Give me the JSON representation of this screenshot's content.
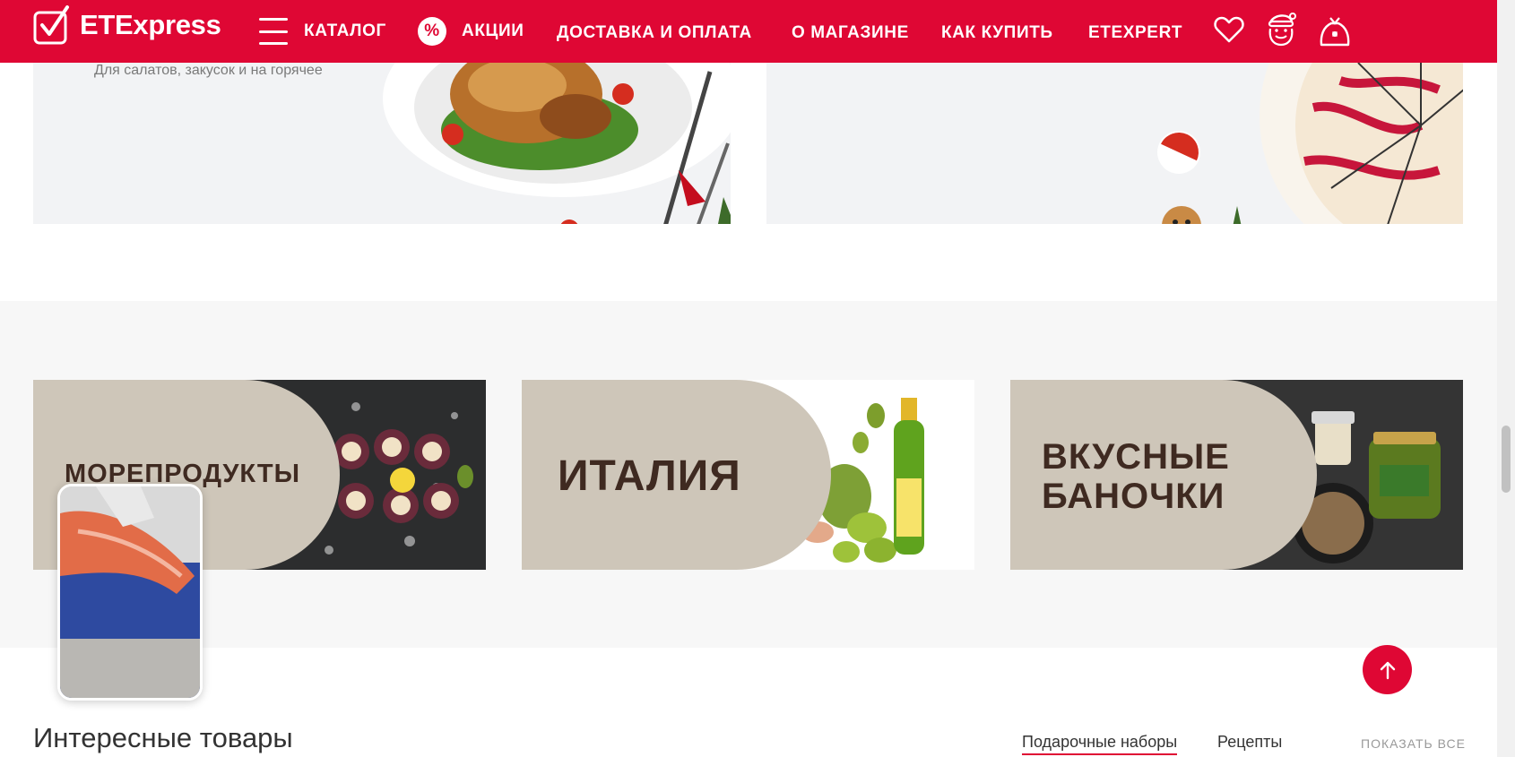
{
  "header": {
    "logo_text": "ETExpress",
    "nav": {
      "catalog": "КАТАЛОГ",
      "promo_icon": "%",
      "promo": "АКЦИИ",
      "delivery": "ДОСТАВКА И ОПЛАТА",
      "about": "О МАГАЗИНЕ",
      "how_to_buy": "КАК КУПИТЬ",
      "etexpert": "ETEXPERT"
    }
  },
  "banners": {
    "left_subtitle": "Для салатов, закусок и на горячее"
  },
  "categories": [
    {
      "label": "МОРЕПРОДУКТЫ"
    },
    {
      "label": "ИТАЛИЯ"
    },
    {
      "label_line1": "ВКУСНЫЕ",
      "label_line2": "БАНОЧКИ"
    }
  ],
  "products": {
    "title": "Интересные товары",
    "tabs": [
      "Подарочные наборы",
      "Рецепты"
    ],
    "show_all": "ПОКАЗАТЬ ВСЕ"
  },
  "colors": {
    "brand_red": "#df0734",
    "category_beige": "#cec6b9",
    "category_text": "#3f2a21"
  }
}
